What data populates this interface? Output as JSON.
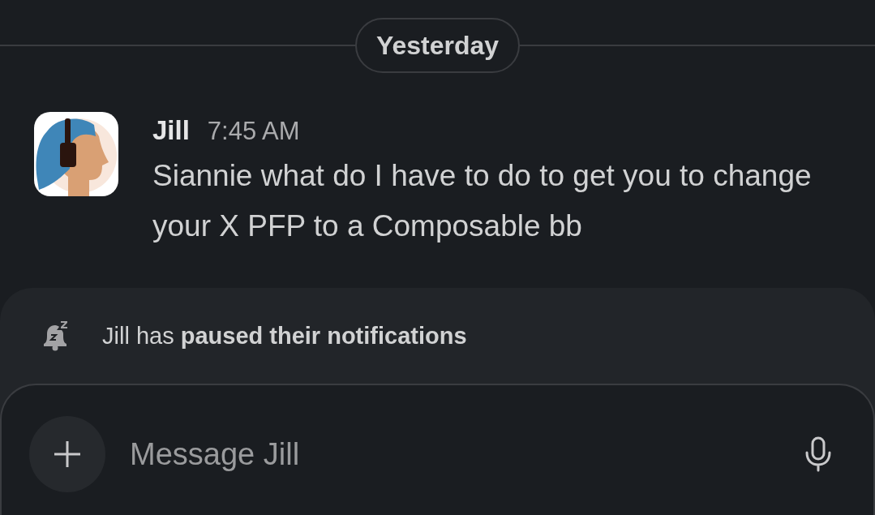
{
  "divider": {
    "label": "Yesterday"
  },
  "message": {
    "author": "Jill",
    "time": "7:45 AM",
    "text": "Siannie what do I have to do to get you to change your X PFP to a Composable bb"
  },
  "notice": {
    "text": "Jill has **paused their notifications**"
  },
  "composer": {
    "placeholder": "Message Jill"
  }
}
